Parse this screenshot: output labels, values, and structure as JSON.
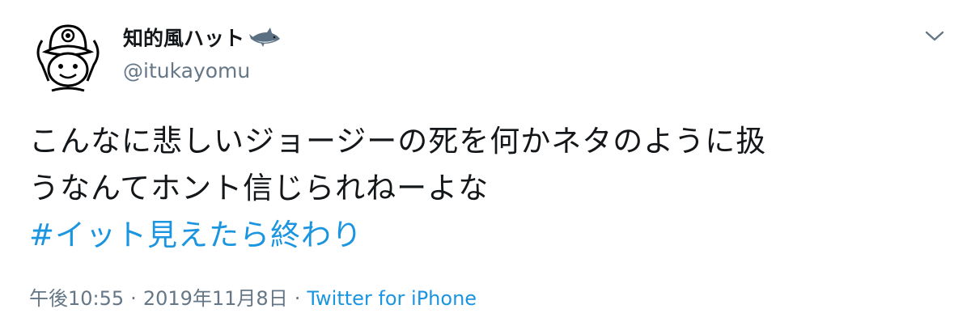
{
  "author": {
    "display_name": "知的風ハット",
    "username": "@itukayomu",
    "name_emoji": "shark-icon",
    "avatar": "hat-character-avatar"
  },
  "tweet": {
    "text_lines": [
      "こんなに悲しいジョージーの死を何かネタのように扱",
      "うなんてホント信じられねーよな"
    ],
    "hashtag": "#イット見えたら終わり"
  },
  "meta": {
    "time": "午後10:55",
    "separator": "·",
    "date": "2019年11月8日",
    "source": "Twitter for iPhone"
  },
  "colors": {
    "text": "#14171a",
    "secondary": "#657786",
    "link": "#1b95e0"
  },
  "icons": {
    "caret": "chevron-down-icon"
  }
}
